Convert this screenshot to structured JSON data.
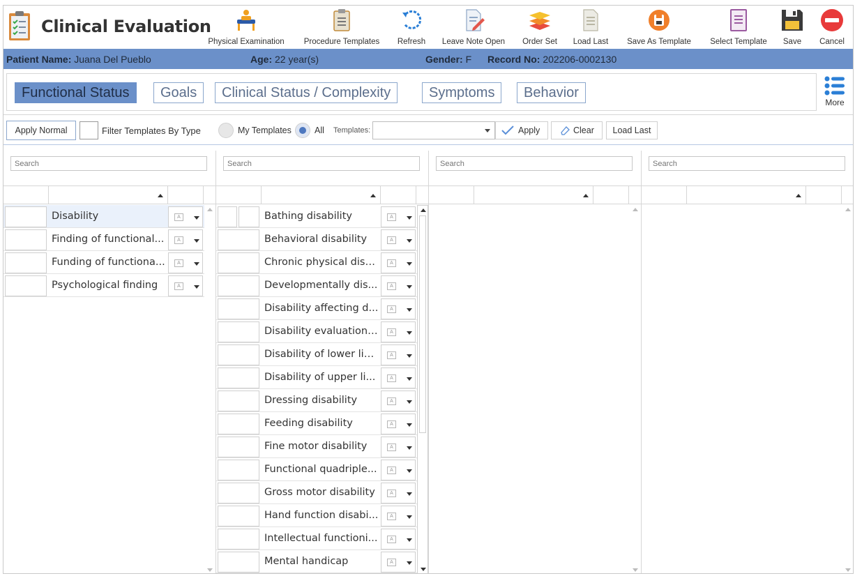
{
  "app": {
    "title": "Clinical Evaluation"
  },
  "toolbar_buttons": [
    {
      "label": "Physical Examination",
      "icon": "physical-examination-icon"
    },
    {
      "label": "Procedure Templates",
      "icon": "clipboard-icon"
    },
    {
      "label": "Refresh",
      "icon": "refresh-icon"
    },
    {
      "label": "Leave Note Open",
      "icon": "edit-note-icon"
    },
    {
      "label": "Order Set",
      "icon": "layers-icon"
    },
    {
      "label": "Load Last",
      "icon": "document-icon"
    },
    {
      "label": "Save As Template",
      "icon": "save-as-template-icon"
    },
    {
      "label": "Select Template",
      "icon": "select-template-icon"
    },
    {
      "label": "Save",
      "icon": "floppy-disk-icon"
    },
    {
      "label": "Cancel",
      "icon": "cancel-icon"
    }
  ],
  "patient": {
    "name_label": "Patient Name:",
    "name": "Juana Del Pueblo",
    "age_label": "Age:",
    "age": "22 year(s)",
    "gender_label": "Gender:",
    "gender": "F",
    "record_label": "Record No:",
    "record": "202206-0002130"
  },
  "tabs": [
    {
      "label": "Functional Status",
      "active": true
    },
    {
      "label": "Goals",
      "active": false
    },
    {
      "label": "Clinical Status / Complexity",
      "active": false
    },
    {
      "label": "Symptoms",
      "active": false
    },
    {
      "label": "Behavior",
      "active": false
    }
  ],
  "more_label": "More",
  "filters": {
    "apply_normal": "Apply Normal",
    "filter_by_type": "Filter Templates By Type",
    "my_templates": "My Templates",
    "all": "All",
    "selected_scope": "All",
    "templates_label": "Templates:",
    "templates_value": "",
    "apply": "Apply",
    "clear": "Clear",
    "load_last": "Load Last"
  },
  "search_placeholder": "Search",
  "panels": [
    {
      "items": [
        "Disability",
        "Finding of functional...",
        "Funding of functiona...",
        "Psychological finding"
      ],
      "selected": 0
    },
    {
      "items": [
        "Bathing disability",
        "Behavioral disability",
        "Chronic physical disa...",
        "Developmentally dis...",
        "Disability  affecting d...",
        "Disability evaluation,...",
        "Disability of lower limb",
        "Disability of upper li...",
        "Dressing disability",
        "Feeding disability",
        "Fine motor disability",
        "Functional quadriple...",
        "Gross motor disability",
        "Hand function disabi...",
        "Intellectual functioni...",
        "Mental handicap"
      ],
      "selected": -1
    },
    {
      "items": [],
      "selected": -1
    },
    {
      "items": [],
      "selected": -1
    }
  ],
  "colors": {
    "accent": "#6b90c9",
    "tab_text": "#5b6e8c",
    "check": "#5a8fd8"
  }
}
